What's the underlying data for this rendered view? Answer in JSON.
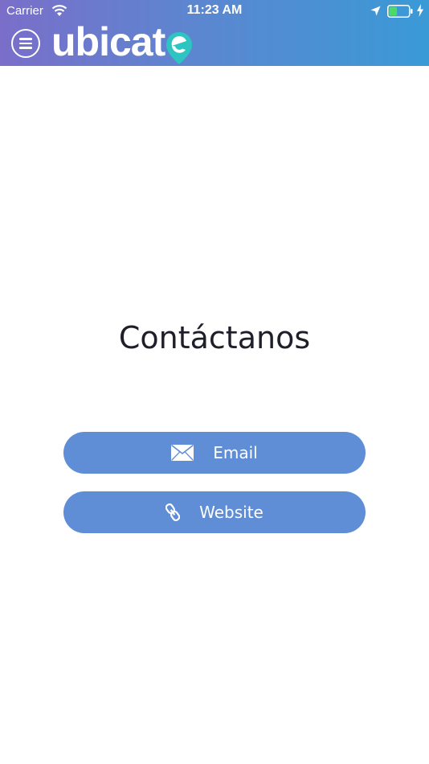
{
  "status_bar": {
    "carrier": "Carrier",
    "time": "11:23 AM",
    "battery_level": 0.4
  },
  "header": {
    "logo_text": "ubicat",
    "icons": [
      "menu-icon",
      "map-pin-logo-icon"
    ]
  },
  "main": {
    "title": "Contáctanos",
    "buttons": [
      {
        "label": "Email",
        "icon": "envelope-icon"
      },
      {
        "label": "Website",
        "icon": "link-icon"
      }
    ]
  },
  "colors": {
    "header_gradient_start": "#7a6ec9",
    "header_gradient_end": "#3a9ad6",
    "button_background": "#5f8dd6",
    "logo_pin": "#2ec4c1",
    "battery_fill": "#4cd964"
  }
}
